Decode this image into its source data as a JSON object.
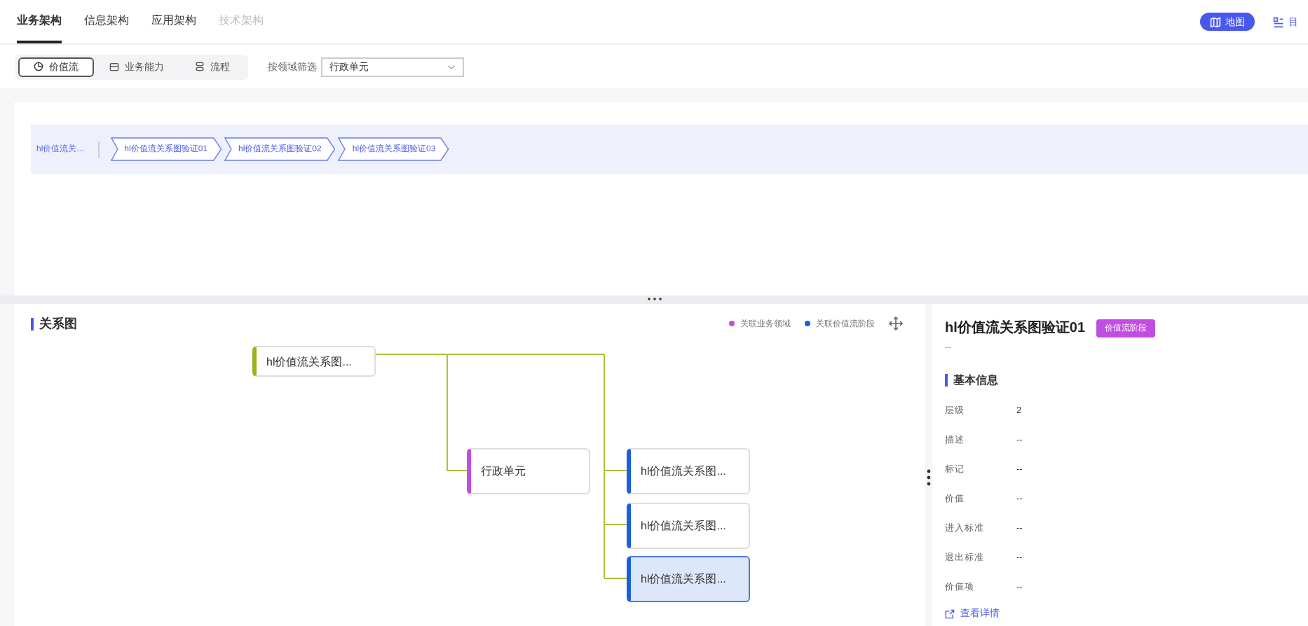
{
  "tabs": [
    {
      "label": "业务架构",
      "selected": true,
      "disabled": false
    },
    {
      "label": "信息架构",
      "selected": false,
      "disabled": false
    },
    {
      "label": "应用架构",
      "selected": false,
      "disabled": false
    },
    {
      "label": "技术架构",
      "selected": false,
      "disabled": true
    }
  ],
  "view_toggle": [
    {
      "label": "地图",
      "selected": true
    },
    {
      "label": "目",
      "selected": false
    }
  ],
  "segments": [
    {
      "label": "价值流",
      "selected": true
    },
    {
      "label": "业务能力",
      "selected": false
    },
    {
      "label": "流程",
      "selected": false
    }
  ],
  "filter": {
    "label": "按领域筛选",
    "value": "行政单元"
  },
  "flow": {
    "root": "hl价值流关...",
    "steps": [
      "hl价值流关系图验证01",
      "hl价值流关系图验证02",
      "hl价值流关系图验证03"
    ]
  },
  "graph": {
    "title": "关系图",
    "legend": [
      {
        "label": "关联业务领域",
        "color": "#c14ee0"
      },
      {
        "label": "关联价值流阶段",
        "color": "#1a5fe0"
      }
    ],
    "root": {
      "label": "hl价值流关系图...",
      "kind": "root",
      "selected": false,
      "children": [
        {
          "label": "行政单元",
          "kind": "domain",
          "selected": false
        },
        {
          "label": "hl价值流关系图...",
          "kind": "stage",
          "selected": false
        },
        {
          "label": "hl价值流关系图...",
          "kind": "stage",
          "selected": false
        },
        {
          "label": "hl价值流关系图...",
          "kind": "stage",
          "selected": true
        }
      ]
    }
  },
  "detail": {
    "title": "hl价值流关系图验证01",
    "badge": "价值流阶段",
    "subtitle": "--",
    "section": "基本信息",
    "fields": [
      {
        "label": "层级",
        "value": "2"
      },
      {
        "label": "描述",
        "value": "--"
      },
      {
        "label": "标记",
        "value": "--"
      },
      {
        "label": "价值",
        "value": "--"
      },
      {
        "label": "进入标准",
        "value": "--"
      },
      {
        "label": "退出标准",
        "value": "--"
      },
      {
        "label": "价值项",
        "value": "--"
      }
    ],
    "link": "查看详情"
  }
}
